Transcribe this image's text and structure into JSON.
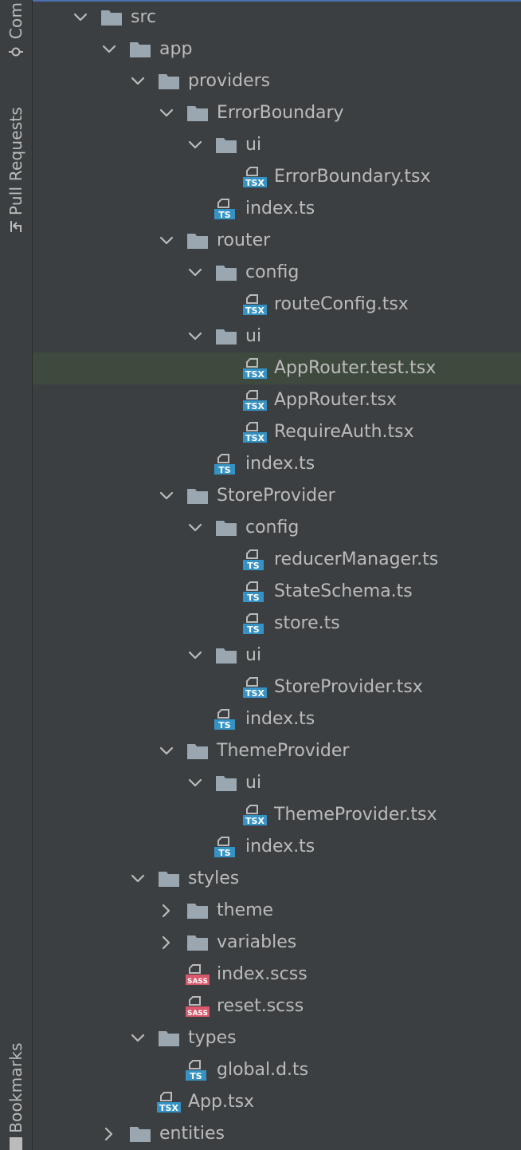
{
  "sidebar": {
    "commit_label": "Com",
    "pull_requests_label": "Pull Requests",
    "bookmarks_label": "Bookmarks"
  },
  "colors": {
    "background": "#3c3f41",
    "text": "#bbbbbb",
    "folder": "#9aa7b0",
    "ts_badge": "#3592c4",
    "sass_badge": "#d9576d",
    "selected_row": "#3f4a3f",
    "accent_line": "#4b6eaf"
  },
  "tree": {
    "items": [
      {
        "label": "src",
        "depth": 0,
        "type": "folder",
        "expanded": true
      },
      {
        "label": "app",
        "depth": 1,
        "type": "folder",
        "expanded": true
      },
      {
        "label": "providers",
        "depth": 2,
        "type": "folder",
        "expanded": true
      },
      {
        "label": "ErrorBoundary",
        "depth": 3,
        "type": "folder",
        "expanded": true
      },
      {
        "label": "ui",
        "depth": 4,
        "type": "folder",
        "expanded": true
      },
      {
        "label": "ErrorBoundary.tsx",
        "depth": 5,
        "type": "file",
        "badge": "TSX"
      },
      {
        "label": "index.ts",
        "depth": 4,
        "type": "file",
        "badge": "TS"
      },
      {
        "label": "router",
        "depth": 3,
        "type": "folder",
        "expanded": true
      },
      {
        "label": "config",
        "depth": 4,
        "type": "folder",
        "expanded": true
      },
      {
        "label": "routeConfig.tsx",
        "depth": 5,
        "type": "file",
        "badge": "TSX"
      },
      {
        "label": "ui",
        "depth": 4,
        "type": "folder",
        "expanded": true
      },
      {
        "label": "AppRouter.test.tsx",
        "depth": 5,
        "type": "file",
        "badge": "TSX",
        "selected": true
      },
      {
        "label": "AppRouter.tsx",
        "depth": 5,
        "type": "file",
        "badge": "TSX"
      },
      {
        "label": "RequireAuth.tsx",
        "depth": 5,
        "type": "file",
        "badge": "TSX"
      },
      {
        "label": "index.ts",
        "depth": 4,
        "type": "file",
        "badge": "TS"
      },
      {
        "label": "StoreProvider",
        "depth": 3,
        "type": "folder",
        "expanded": true
      },
      {
        "label": "config",
        "depth": 4,
        "type": "folder",
        "expanded": true
      },
      {
        "label": "reducerManager.ts",
        "depth": 5,
        "type": "file",
        "badge": "TS"
      },
      {
        "label": "StateSchema.ts",
        "depth": 5,
        "type": "file",
        "badge": "TS"
      },
      {
        "label": "store.ts",
        "depth": 5,
        "type": "file",
        "badge": "TS"
      },
      {
        "label": "ui",
        "depth": 4,
        "type": "folder",
        "expanded": true
      },
      {
        "label": "StoreProvider.tsx",
        "depth": 5,
        "type": "file",
        "badge": "TSX"
      },
      {
        "label": "index.ts",
        "depth": 4,
        "type": "file",
        "badge": "TS"
      },
      {
        "label": "ThemeProvider",
        "depth": 3,
        "type": "folder",
        "expanded": true
      },
      {
        "label": "ui",
        "depth": 4,
        "type": "folder",
        "expanded": true
      },
      {
        "label": "ThemeProvider.tsx",
        "depth": 5,
        "type": "file",
        "badge": "TSX"
      },
      {
        "label": "index.ts",
        "depth": 4,
        "type": "file",
        "badge": "TS"
      },
      {
        "label": "styles",
        "depth": 2,
        "type": "folder",
        "expanded": true
      },
      {
        "label": "theme",
        "depth": 3,
        "type": "folder",
        "expanded": false
      },
      {
        "label": "variables",
        "depth": 3,
        "type": "folder",
        "expanded": false
      },
      {
        "label": "index.scss",
        "depth": 3,
        "type": "file",
        "badge": "SASS"
      },
      {
        "label": "reset.scss",
        "depth": 3,
        "type": "file",
        "badge": "SASS"
      },
      {
        "label": "types",
        "depth": 2,
        "type": "folder",
        "expanded": true
      },
      {
        "label": "global.d.ts",
        "depth": 3,
        "type": "file",
        "badge": "TS"
      },
      {
        "label": "App.tsx",
        "depth": 2,
        "type": "file",
        "badge": "TSX"
      },
      {
        "label": "entities",
        "depth": 1,
        "type": "folder",
        "expanded": false
      }
    ]
  }
}
